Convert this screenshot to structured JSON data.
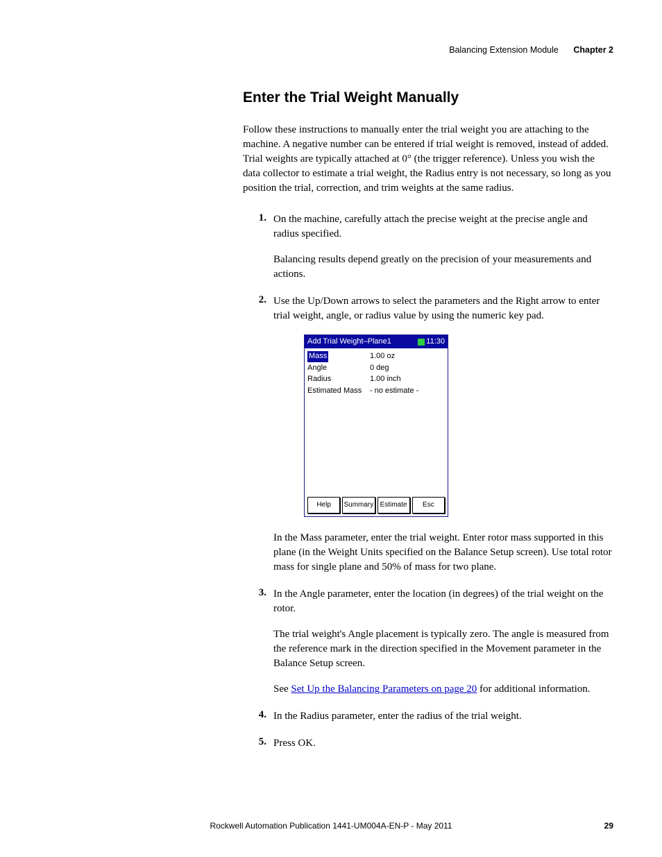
{
  "header": {
    "section": "Balancing Extension Module",
    "chapter": "Chapter 2"
  },
  "title": "Enter the Trial Weight Manually",
  "intro": "Follow these instructions to manually enter the trial weight you are attaching to the machine. A negative number can be entered if trial weight is removed, instead of added. Trial weights are typically attached at 0° (the trigger reference). Unless you wish the data collector to estimate a trial weight, the Radius entry is not necessary, so long as you position the trial, correction, and trim weights at the same radius.",
  "steps": {
    "s1": {
      "num": "1.",
      "p1": "On the machine, carefully attach the precise weight at the precise angle and radius specified.",
      "p2": "Balancing results depend greatly on the precision of your measurements and actions."
    },
    "s2": {
      "num": "2.",
      "p1": "Use the Up/Down arrows to select the parameters and the Right arrow to enter trial weight, angle, or radius value by using the numeric key pad.",
      "p2": "In the Mass parameter, enter the trial weight. Enter rotor mass supported in this plane (in the Weight Units specified on the Balance Setup screen). Use total rotor mass for single plane and 50% of mass for two plane."
    },
    "s3": {
      "num": "3.",
      "p1": "In the Angle parameter, enter the location (in degrees) of the trial weight on the rotor.",
      "p2": "The trial weight's Angle placement is typically zero. The angle is measured from the reference mark in the direction specified in the Movement parameter in the Balance Setup screen.",
      "p3_pre": "See ",
      "p3_link": "Set Up the Balancing Parameters on page 20",
      "p3_post": " for additional information."
    },
    "s4": {
      "num": "4.",
      "p1": "In the Radius parameter, enter the radius of the trial weight."
    },
    "s5": {
      "num": "5.",
      "p1": "Press OK."
    }
  },
  "device": {
    "title": "Add Trial Weight–Plane1",
    "time": "11:30",
    "rows": {
      "r0": {
        "label": "Mass",
        "value": "1.00 oz"
      },
      "r1": {
        "label": "Angle",
        "value": "0 deg"
      },
      "r2": {
        "label": "Radius",
        "value": "1.00 inch"
      },
      "r3": {
        "label": "Estimated Mass",
        "value": "- no estimate -"
      }
    },
    "buttons": {
      "b0": "Help",
      "b1": "Summary",
      "b2": "Estimate",
      "b3": "Esc"
    }
  },
  "footer": {
    "pub": "Rockwell Automation Publication 1441-UM004A-EN-P - May 2011",
    "page": "29"
  }
}
